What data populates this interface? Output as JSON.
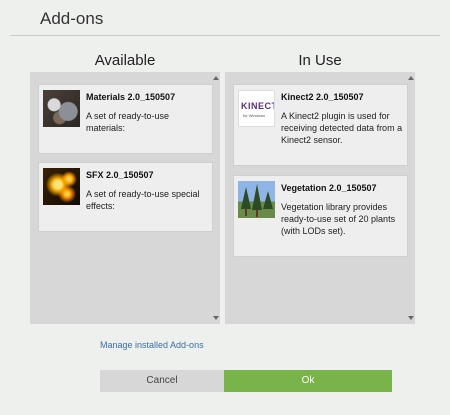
{
  "window": {
    "title": "Add-ons"
  },
  "columns": {
    "available": {
      "heading": "Available"
    },
    "in_use": {
      "heading": "In Use"
    }
  },
  "available_addons": [
    {
      "title": "Materials 2.0_150507",
      "description": "A set of ready-to-use materials:",
      "icon": "materials-thumbnail"
    },
    {
      "title": "SFX 2.0_150507",
      "description": "A set of ready-to-use special effects:",
      "icon": "sfx-thumbnail"
    }
  ],
  "in_use_addons": [
    {
      "title": "Kinect2 2.0_150507",
      "description": "A Kinect2 plugin is used for receiving detected data from a Kinect2 sensor.",
      "icon": "kinect-logo",
      "logo_text": "KINECT",
      "logo_subtext": "for Windows"
    },
    {
      "title": "Vegetation 2.0_150507",
      "description": "Vegetation library provides ready-to-use set of 20 plants (with LODs set).",
      "icon": "vegetation-thumbnail"
    }
  ],
  "links": {
    "manage": "Manage installed Add-ons"
  },
  "buttons": {
    "cancel": "Cancel",
    "ok": "Ok"
  },
  "colors": {
    "ok_button": "#78b44a",
    "link": "#3a6ea5",
    "panel": "#d6d7d6"
  }
}
